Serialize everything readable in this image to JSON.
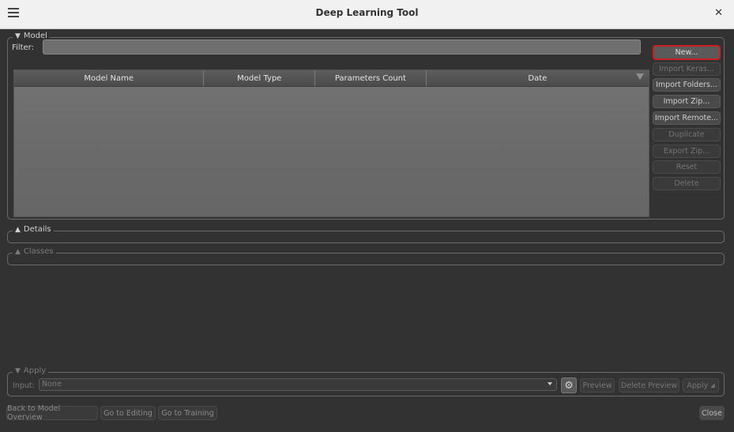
{
  "window": {
    "title": "Deep Learning Tool"
  },
  "model": {
    "group_title": "Model",
    "filter_label": "Filter:",
    "filter_value": "",
    "columns": [
      "Model Name",
      "Model Type",
      "Parameters Count",
      "Date"
    ],
    "buttons": {
      "new": "New...",
      "import_keras": "Import Keras...",
      "import_folders": "Import Folders...",
      "import_zip": "Import Zip...",
      "import_remote": "Import Remote...",
      "duplicate": "Duplicate",
      "export_zip": "Export Zip...",
      "reset": "Reset",
      "delete": "Delete"
    }
  },
  "details": {
    "group_title": "Details"
  },
  "classes": {
    "group_title": "Classes"
  },
  "apply": {
    "group_title": "Apply",
    "input_label": "Input:",
    "input_value": "None",
    "preview": "Preview",
    "delete_preview": "Delete Preview",
    "apply": "Apply"
  },
  "footer": {
    "back": "Back to Model Overview",
    "editing": "Go to Editing",
    "training": "Go to Training",
    "close": "Close"
  },
  "colors": {
    "highlight": "#cc1f1f",
    "background": "#323232"
  }
}
